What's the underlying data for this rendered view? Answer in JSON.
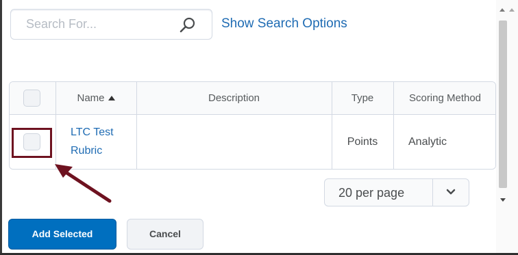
{
  "search": {
    "placeholder": "Search For...",
    "options_link": "Show Search Options"
  },
  "table": {
    "columns": [
      "Name",
      "Description",
      "Type",
      "Scoring Method"
    ],
    "sort_column": "Name",
    "sort_direction": "ascending",
    "rows": [
      {
        "name_line1": "LTC Test",
        "name_line2": "Rubric",
        "description": "",
        "type": "Points",
        "scoring_method": "Analytic",
        "checked": false
      }
    ]
  },
  "pagination": {
    "per_page_label": "20 per page"
  },
  "buttons": {
    "add_selected": "Add Selected",
    "cancel": "Cancel"
  },
  "colors": {
    "link": "#1e6bb3",
    "primary_button": "#006fbf",
    "highlight_box": "#6e1220"
  },
  "annotation": {
    "highlight": "row-checkbox",
    "arrow_icon": "arrow-up-left-icon"
  }
}
